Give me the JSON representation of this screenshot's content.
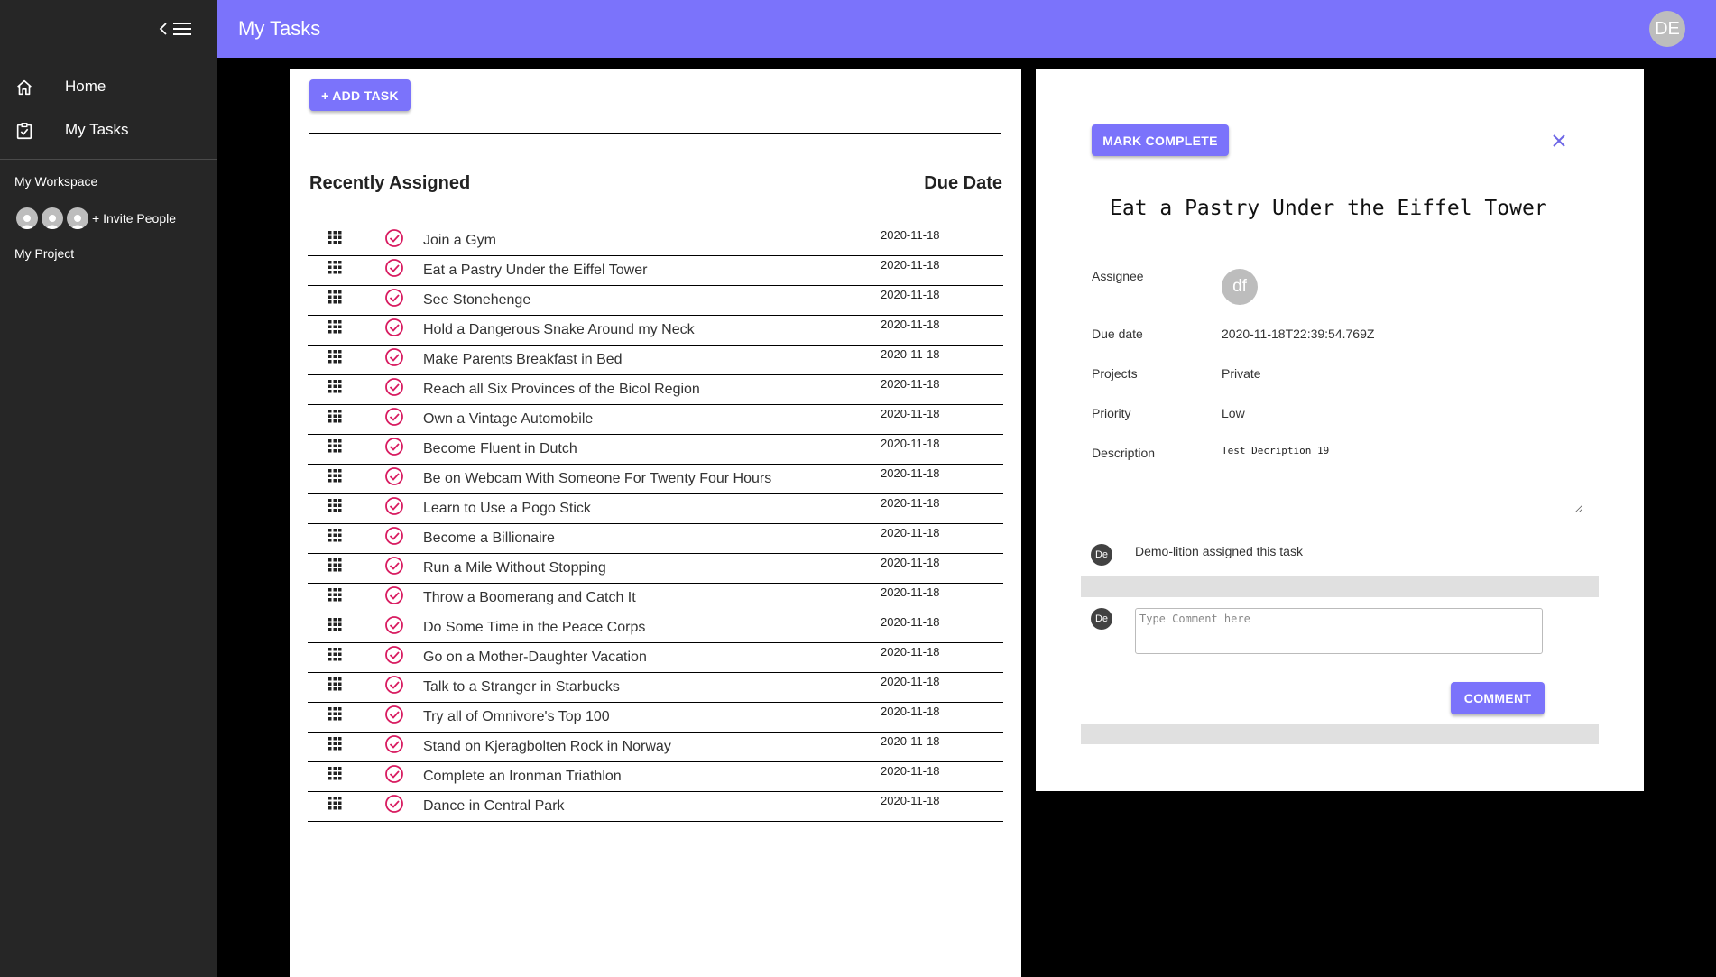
{
  "header": {
    "title": "My Tasks",
    "avatar_initials": "DE",
    "accent_color": "#7b73fb"
  },
  "sidebar": {
    "nav": [
      {
        "label": "Home",
        "icon": "home-icon"
      },
      {
        "label": "My Tasks",
        "icon": "task-check-icon"
      }
    ],
    "workspace_label": "My Workspace",
    "invite_label": "+ Invite People",
    "project_label": "My Project"
  },
  "task_list": {
    "add_task_label": "+ ADD TASK",
    "heading": "Recently Assigned",
    "due_heading": "Due Date",
    "tasks": [
      {
        "name": "Join a Gym",
        "due": "2020-11-18"
      },
      {
        "name": "Eat a Pastry Under the Eiffel Tower",
        "due": "2020-11-18"
      },
      {
        "name": "See Stonehenge",
        "due": "2020-11-18"
      },
      {
        "name": "Hold a Dangerous Snake Around my Neck",
        "due": "2020-11-18"
      },
      {
        "name": "Make Parents Breakfast in Bed",
        "due": "2020-11-18"
      },
      {
        "name": "Reach all Six Provinces of the Bicol Region",
        "due": "2020-11-18"
      },
      {
        "name": "Own a Vintage Automobile",
        "due": "2020-11-18"
      },
      {
        "name": "Become Fluent in Dutch",
        "due": "2020-11-18"
      },
      {
        "name": "Be on Webcam With Someone For Twenty Four Hours",
        "due": "2020-11-18"
      },
      {
        "name": "Learn to Use a Pogo Stick",
        "due": "2020-11-18"
      },
      {
        "name": "Become a Billionaire",
        "due": "2020-11-18"
      },
      {
        "name": "Run a Mile Without Stopping",
        "due": "2020-11-18"
      },
      {
        "name": "Throw a Boomerang and Catch It",
        "due": "2020-11-18"
      },
      {
        "name": "Do Some Time in the Peace Corps",
        "due": "2020-11-18"
      },
      {
        "name": "Go on a Mother-Daughter Vacation",
        "due": "2020-11-18"
      },
      {
        "name": "Talk to a Stranger in Starbucks",
        "due": "2020-11-18"
      },
      {
        "name": "Try all of Omnivore's Top 100",
        "due": "2020-11-18"
      },
      {
        "name": "Stand on Kjeragbolten Rock in Norway",
        "due": "2020-11-18"
      },
      {
        "name": "Complete an Ironman Triathlon",
        "due": "2020-11-18"
      },
      {
        "name": "Dance in Central Park",
        "due": "2020-11-18"
      }
    ]
  },
  "detail": {
    "mark_complete_label": "MARK COMPLETE",
    "title": "Eat a Pastry Under the Eiffel Tower",
    "assignee_label": "Assignee",
    "assignee_initials": "df",
    "due_label": "Due date",
    "due_value": "2020-11-18T22:39:54.769Z",
    "projects_label": "Projects",
    "projects_value": "Private",
    "priority_label": "Priority",
    "priority_value": "Low",
    "description_label": "Description",
    "description_value": "Test Decription 19",
    "activity_avatar": "De",
    "activity_text": "Demo-lition assigned this task",
    "comment_avatar": "De",
    "comment_placeholder": "Type Comment here",
    "comment_button_label": "COMMENT"
  }
}
